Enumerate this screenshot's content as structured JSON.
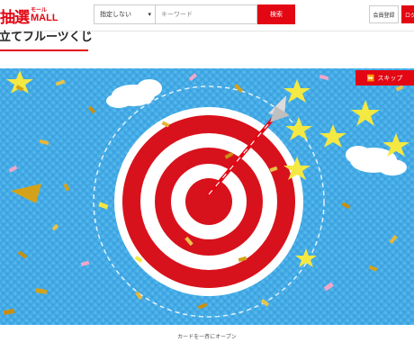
{
  "logo": {
    "kanji": "抽選",
    "small": "モール",
    "mall": "MALL"
  },
  "search": {
    "select_value": "指定しない",
    "placeholder": "キーワード",
    "button": "検索"
  },
  "header": {
    "register": "会員登録",
    "login": "ログ"
  },
  "page": {
    "title": "的立てフルーツくじ"
  },
  "stage": {
    "skip_label": "スキップ"
  },
  "footer": {
    "note": "カードを一斉にオープン"
  },
  "colors": {
    "brand_red": "#e30613",
    "sky_blue": "#3aa3e3",
    "target_red": "#d8121c"
  },
  "icons": {
    "select_chevron": "chevron-down-icon",
    "skip_icon": "fast-forward-icon"
  }
}
